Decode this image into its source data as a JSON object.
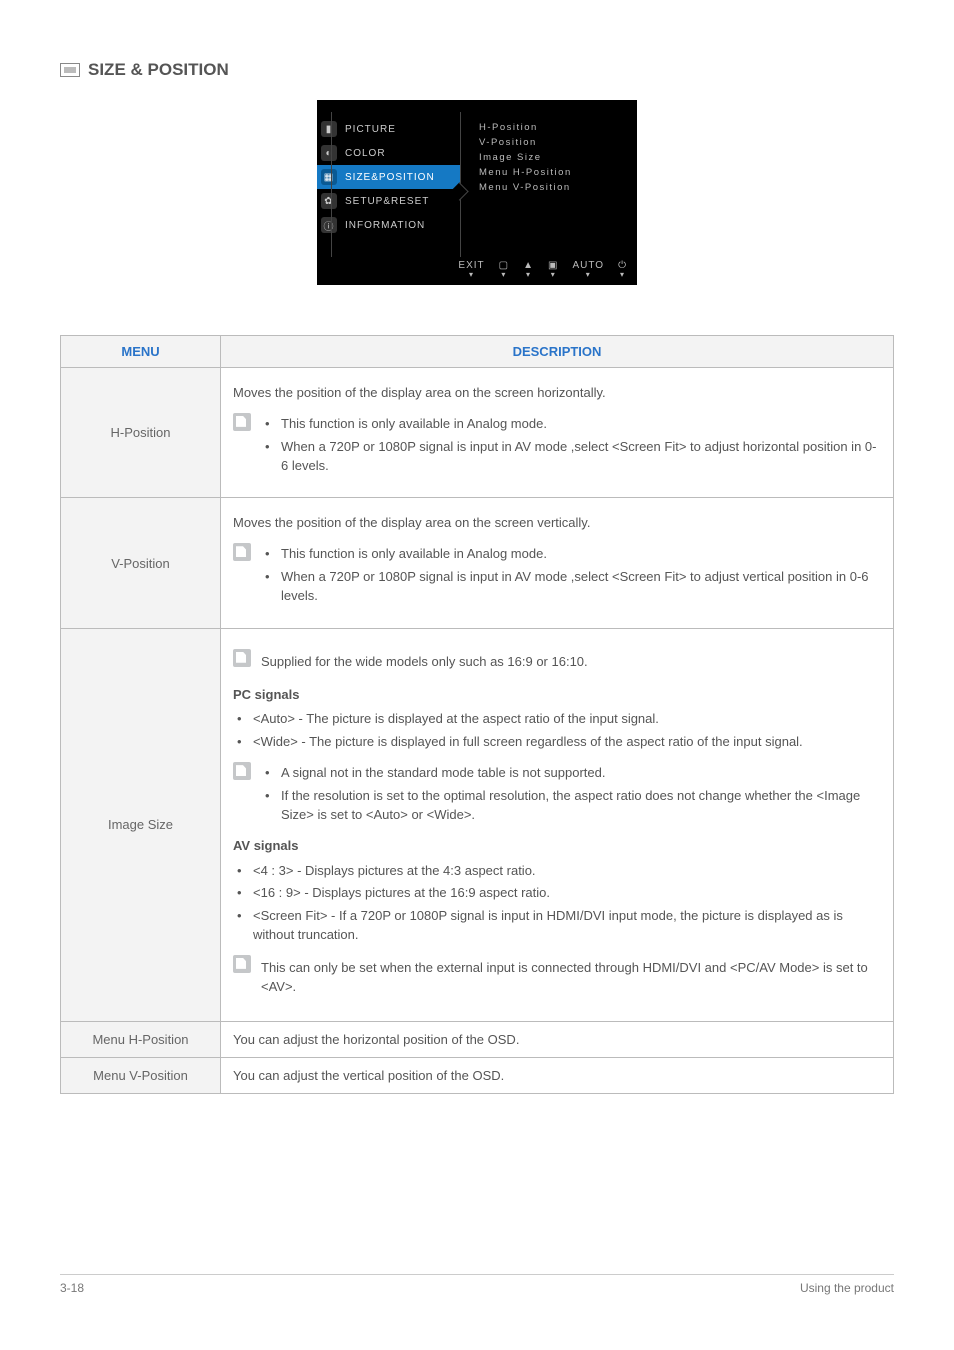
{
  "page_title": "SIZE & POSITION",
  "osd": {
    "left_items": [
      {
        "icon": "▮",
        "label": "PICTURE",
        "selected": false
      },
      {
        "icon": "◐",
        "label": "COLOR",
        "selected": false
      },
      {
        "icon": "▦",
        "label": "SIZE&POSITION",
        "selected": true
      },
      {
        "icon": "✿",
        "label": "SETUP&RESET",
        "selected": false
      },
      {
        "icon": "ⓘ",
        "label": "INFORMATION",
        "selected": false
      }
    ],
    "right_items": [
      "H-Position",
      "V-Position",
      "Image Size",
      "Menu H-Position",
      "Menu V-Position"
    ],
    "foot": [
      "EXIT",
      "▢",
      "▲",
      "▣",
      "AUTO",
      "⏻"
    ]
  },
  "table": {
    "headers": {
      "menu": "MENU",
      "desc": "DESCRIPTION"
    },
    "rows": [
      {
        "menu": "H-Position",
        "intro": "Moves the position of the display area on the screen horizontally.",
        "note_bullets": [
          "This function is only available in Analog mode.",
          "When a 720P or 1080P signal is input in AV mode ,select <Screen Fit> to adjust horizontal position in 0-6 levels."
        ]
      },
      {
        "menu": "V-Position",
        "intro": "Moves the position of the display area on the screen vertically.",
        "note_bullets": [
          "This function is only available in Analog mode.",
          "When a 720P or 1080P signal is input in AV mode ,select <Screen Fit> to adjust vertical position in 0-6 levels."
        ]
      },
      {
        "menu": "Image Size",
        "top_note": "Supplied for the wide models only such as 16:9 or 16:10.",
        "pc_heading": "PC signals",
        "pc_bullets": [
          "<Auto> - The picture is displayed at the aspect ratio of the input signal.",
          "<Wide> - The picture is displayed in full screen regardless of the aspect ratio of the input signal."
        ],
        "pc_note_bullets": [
          "A signal not in the standard mode table is not supported.",
          "If the resolution is set to the optimal resolution, the aspect ratio does not change whether the <Image Size> is set to <Auto> or <Wide>."
        ],
        "av_heading": "AV signals",
        "av_bullets": [
          "<4 : 3> - Displays pictures at the 4:3 aspect ratio.",
          "<16 : 9> - Displays pictures at the 16:9 aspect ratio.",
          "<Screen Fit> - If a 720P or 1080P signal is input in HDMI/DVI input mode, the picture is displayed as is without truncation."
        ],
        "av_note": "This can only be set when the external input is connected through HDMI/DVI and <PC/AV Mode> is set to <AV>."
      },
      {
        "menu": "Menu H-Position",
        "simple": "You can adjust the horizontal position of the OSD."
      },
      {
        "menu": "Menu V-Position",
        "simple": "You can adjust the vertical position of the OSD."
      }
    ]
  },
  "footer_left": "3-18",
  "footer_right": "Using the product"
}
